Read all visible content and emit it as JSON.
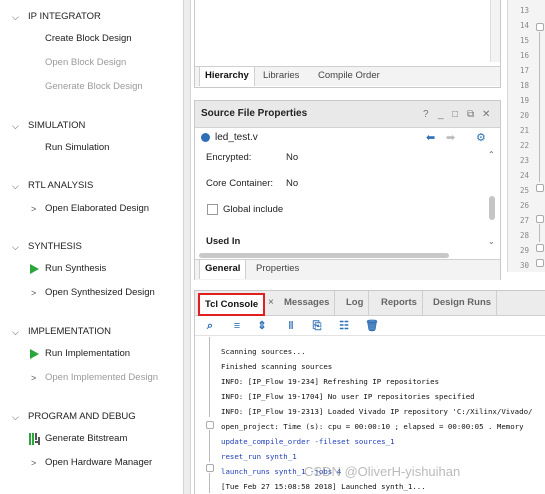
{
  "flow_navigator": {
    "sections": [
      {
        "label": "IP INTEGRATOR",
        "items": [
          {
            "label": "Create Block Design",
            "enabled": true
          },
          {
            "label": "Open Block Design",
            "enabled": false
          },
          {
            "label": "Generate Block Design",
            "enabled": false
          }
        ]
      },
      {
        "label": "SIMULATION",
        "items": [
          {
            "label": "Run Simulation",
            "enabled": true
          }
        ]
      },
      {
        "label": "RTL ANALYSIS",
        "items": [
          {
            "label": "Open Elaborated Design",
            "enabled": true
          }
        ]
      },
      {
        "label": "SYNTHESIS",
        "items": [
          {
            "label": "Run Synthesis",
            "enabled": true
          },
          {
            "label": "Open Synthesized Design",
            "enabled": true
          }
        ]
      },
      {
        "label": "IMPLEMENTATION",
        "items": [
          {
            "label": "Run Implementation",
            "enabled": true
          },
          {
            "label": "Open Implemented Design",
            "enabled": false
          }
        ]
      },
      {
        "label": "PROGRAM AND DEBUG",
        "items": [
          {
            "label": "Generate Bitstream",
            "enabled": true
          },
          {
            "label": "Open Hardware Manager",
            "enabled": true
          }
        ]
      }
    ]
  },
  "sources": {
    "tabs": [
      "Hierarchy",
      "Libraries",
      "Compile Order"
    ],
    "active_tab": "Hierarchy"
  },
  "source_file_properties": {
    "title": "Source File Properties",
    "controls": [
      "?",
      "_",
      "□",
      "⧉",
      "✕"
    ],
    "file_name": "led_test.v",
    "encrypted_label": "Encrypted:",
    "encrypted_value": "No",
    "core_container_label": "Core Container:",
    "core_container_value": "No",
    "global_include_label": "Global include",
    "used_in_label": "Used In",
    "tabs": [
      "General",
      "Properties"
    ],
    "active_tab": "General"
  },
  "editor_gutter": {
    "line_numbers": [
      "13",
      "14",
      "15",
      "16",
      "17",
      "18",
      "19",
      "20",
      "21",
      "22",
      "23",
      "24",
      "25",
      "26",
      "27",
      "28",
      "29",
      "30"
    ]
  },
  "console": {
    "tabs": [
      "Tcl Console",
      "Messages",
      "Log",
      "Reports",
      "Design Runs"
    ],
    "active_tab": "Tcl Console",
    "highlight_color": "#e02020",
    "lines": [
      {
        "text": "Scanning sources...",
        "kind": "output"
      },
      {
        "text": "Finished scanning sources",
        "kind": "output"
      },
      {
        "text": "INFO: [IP_Flow 19-234] Refreshing IP repositories",
        "kind": "output"
      },
      {
        "text": "INFO: [IP_Flow 19-1704] No user IP repositories specified",
        "kind": "output"
      },
      {
        "text": "INFO: [IP_Flow 19-2313] Loaded Vivado IP repository 'C:/Xilinx/Vivado/",
        "kind": "output"
      },
      {
        "text": "open_project: Time (s): cpu = 00:00:10 ; elapsed = 00:00:05 . Memory",
        "kind": "output"
      },
      {
        "text": "update_compile_order -fileset sources_1",
        "kind": "command"
      },
      {
        "text": "reset_run synth_1",
        "kind": "command"
      },
      {
        "text": "launch_runs synth_1 -jobs 4",
        "kind": "command"
      },
      {
        "text": "[Tue Feb 27 15:08:58 2018] Launched synth_1...",
        "kind": "output"
      }
    ]
  },
  "watermark": "CSDN @OliverH-yishuihan"
}
